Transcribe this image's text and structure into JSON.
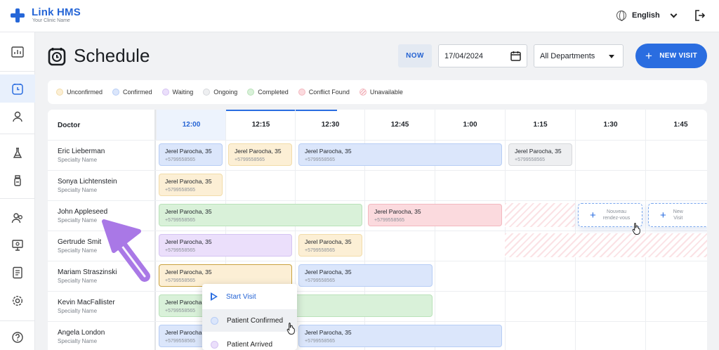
{
  "app": {
    "name": "Link HMS",
    "subtitle": "Your Clinic Name"
  },
  "header": {
    "language": "English"
  },
  "page": {
    "title": "Schedule"
  },
  "toolbar": {
    "now_label": "NOW",
    "date_value": "17/04/2024",
    "department_value": "All Departments",
    "new_visit_label": "NEW VISIT"
  },
  "legend": [
    {
      "label": "Unconfirmed",
      "color": "#fcefd5"
    },
    {
      "label": "Confirmed",
      "color": "#dbe6fb"
    },
    {
      "label": "Waiting",
      "color": "#ebdffb"
    },
    {
      "label": "Ongoing",
      "color": "#eeeff1"
    },
    {
      "label": "Completed",
      "color": "#d9f1d9"
    },
    {
      "label": "Conflict Found",
      "color": "#fbdade"
    },
    {
      "label": "Unavailable",
      "color": "#fbe2e5"
    }
  ],
  "grid": {
    "doctor_header": "Doctor",
    "times": [
      "12:00",
      "12:15",
      "12:30",
      "12:45",
      "1:00",
      "1:15",
      "1:30",
      "1:45"
    ],
    "doctors": [
      {
        "name": "Eric Lieberman",
        "specialty": "Specialty Name"
      },
      {
        "name": "Sonya Lichtenstein",
        "specialty": "Specialty Name"
      },
      {
        "name": "John Appleseed",
        "specialty": "Specialty Name"
      },
      {
        "name": "Gertrude Smit",
        "specialty": "Specialty Name"
      },
      {
        "name": "Mariam Straszinski",
        "specialty": "Specialty Name"
      },
      {
        "name": "Kevin MacFallister",
        "specialty": "Specialty Name"
      },
      {
        "name": "Angela London",
        "specialty": "Specialty Name"
      }
    ],
    "appointment": {
      "patient": "Jerel Parocha, 35",
      "phone": "+5799558565",
      "patient_short": "Jerel Parocha"
    },
    "new_slot_fr": {
      "line1": "Nouveau",
      "line2": "rendez-vous"
    },
    "new_slot_en": {
      "line1": "New",
      "line2": "Visit"
    }
  },
  "context_menu": {
    "items": [
      {
        "label": "Start Visit"
      },
      {
        "label": "Patient Confirmed"
      },
      {
        "label": "Patient Arrived"
      }
    ]
  }
}
